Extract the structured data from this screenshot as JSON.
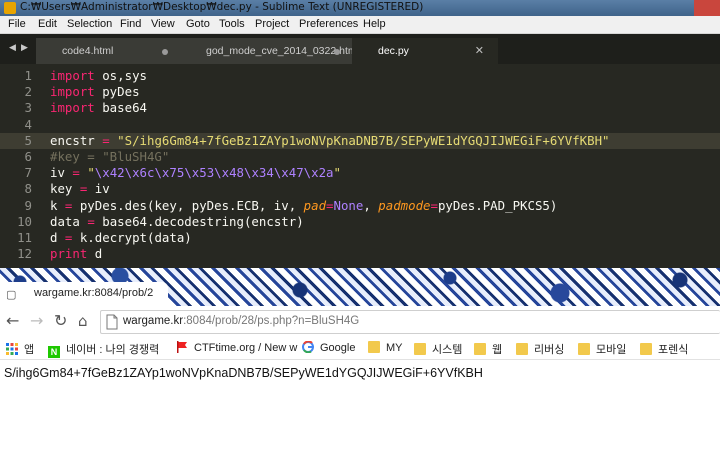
{
  "sublime": {
    "title": "C:₩Users₩Administrator₩Desktop₩dec.py - Sublime Text (UNREGISTERED)",
    "menu": [
      "File",
      "Edit",
      "Selection",
      "Find",
      "View",
      "Goto",
      "Tools",
      "Project",
      "Preferences",
      "Help"
    ],
    "tabs": [
      {
        "label": "code4.html",
        "modified": true
      },
      {
        "label": "god_mode_cve_2014_0322.html",
        "modified": true
      },
      {
        "label": "dec.py",
        "active": true
      }
    ],
    "current_line": 5,
    "code_lines": [
      [
        {
          "t": "import",
          "c": "kw"
        },
        {
          "t": " os,sys"
        }
      ],
      [
        {
          "t": "import",
          "c": "kw"
        },
        {
          "t": " pyDes"
        }
      ],
      [
        {
          "t": "import",
          "c": "kw"
        },
        {
          "t": " base64"
        }
      ],
      [],
      [
        {
          "t": "encstr "
        },
        {
          "t": "=",
          "c": "kw"
        },
        {
          "t": " "
        },
        {
          "t": "\"S/ihg6Gm84+7fGeBz1ZAYp1woNVpKnaDNB7B/SEPyWE1dYGQJIJWEGiF+6YVfKBH\"",
          "c": "st"
        }
      ],
      [
        {
          "t": "#key = \"BluSH4G\"",
          "c": "cm"
        }
      ],
      [
        {
          "t": "iv "
        },
        {
          "t": "=",
          "c": "kw"
        },
        {
          "t": " "
        },
        {
          "t": "\"",
          "c": "st"
        },
        {
          "t": "\\x42\\x6c\\x75\\x53\\x48\\x34\\x47\\x2a",
          "c": "esc"
        },
        {
          "t": "\"",
          "c": "st"
        }
      ],
      [
        {
          "t": "key "
        },
        {
          "t": "=",
          "c": "kw"
        },
        {
          "t": " iv"
        }
      ],
      [
        {
          "t": "k "
        },
        {
          "t": "=",
          "c": "kw"
        },
        {
          "t": " pyDes.des(key, pyDes.ECB, iv, "
        },
        {
          "t": "pad",
          "c": "pm"
        },
        {
          "t": "=",
          "c": "kw"
        },
        {
          "t": "None",
          "c": "cn"
        },
        {
          "t": ", "
        },
        {
          "t": "padmode",
          "c": "pm"
        },
        {
          "t": "=",
          "c": "kw"
        },
        {
          "t": "pyDes.PAD_PKCS5)"
        }
      ],
      [
        {
          "t": "data "
        },
        {
          "t": "=",
          "c": "kw"
        },
        {
          "t": " base64.decodestring(encstr)"
        }
      ],
      [
        {
          "t": "d "
        },
        {
          "t": "=",
          "c": "kw"
        },
        {
          "t": " k.decrypt(data)"
        }
      ],
      [
        {
          "t": "print",
          "c": "kw"
        },
        {
          "t": " d"
        }
      ]
    ]
  },
  "chrome": {
    "tab_title": "wargame.kr:8084/prob/2",
    "url_host": "wargame.kr",
    "url_rest": ":8084/prob/28/ps.php?n=BluSH4G",
    "bookmarks": [
      {
        "label": "앱",
        "icon": "apps-grid-icon"
      },
      {
        "label": "네이버 : 나의 경쟁력",
        "icon": "naver-icon"
      },
      {
        "label": "CTFtime.org / New w",
        "icon": "ctftime-flag-icon"
      },
      {
        "label": "Google",
        "icon": "google-icon"
      },
      {
        "label": "MY",
        "icon": "folder-icon"
      },
      {
        "label": "시스템",
        "icon": "folder-icon"
      },
      {
        "label": "웹",
        "icon": "folder-icon"
      },
      {
        "label": "리버싱",
        "icon": "folder-icon"
      },
      {
        "label": "모바일",
        "icon": "folder-icon"
      },
      {
        "label": "포렌식",
        "icon": "folder-icon"
      }
    ],
    "page_text": "S/ihg6Gm84+7fGeBz1ZAYp1woNVpKnaDNB7B/SEPyWE1dYGQJIJWEGiF+6YVfKBH"
  },
  "colors": {
    "editor_bg": "#272822",
    "keyword": "#f92672",
    "string": "#e6db74",
    "escape": "#ae81ff",
    "comment": "#75715e",
    "param": "#fd971f"
  }
}
